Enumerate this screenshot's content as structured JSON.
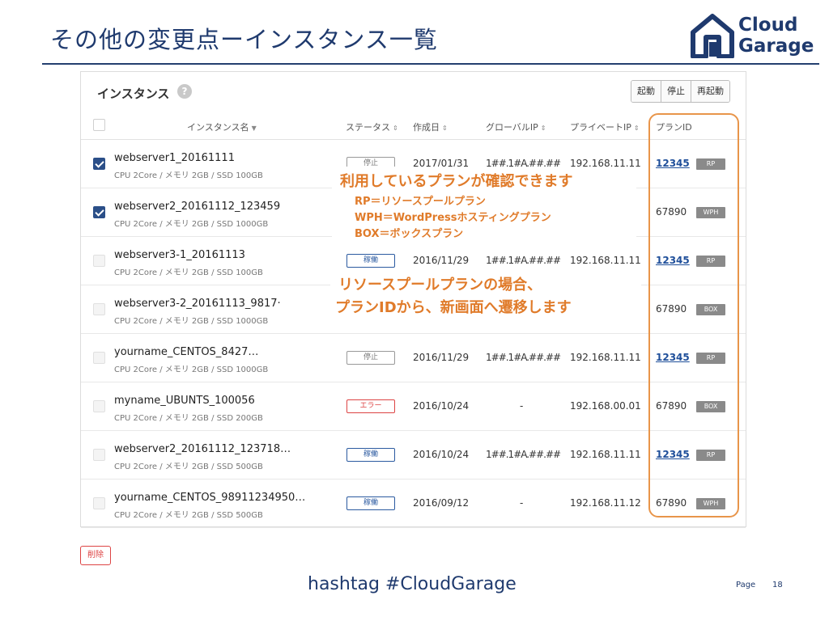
{
  "slide": {
    "title": "その他の変更点ーインスタンス一覧",
    "hashtag": "hashtag  #CloudGarage",
    "page_label": "Page",
    "page_number": "18"
  },
  "logo": {
    "line1": "Cloud",
    "line2": "Garage",
    "color": "#1f3a6e"
  },
  "panel": {
    "title": "インスタンス",
    "help": "?",
    "buttons": [
      "起動",
      "停止",
      "再起動"
    ],
    "headers": {
      "name": "インスタンス名",
      "status": "ステータス",
      "created": "作成日",
      "global_ip": "グローバルIP",
      "private_ip": "プライベートIP",
      "plan_id": "プランID"
    },
    "rows": [
      {
        "checked": true,
        "name": "webserver1_20161111",
        "spec": "CPU 2Core / メモリ 2GB / SSD 100GB",
        "status": "停止",
        "status_type": "stopped",
        "created": "2017/01/31",
        "global_ip": "1##.1#A.##.##",
        "private_ip": "192.168.11.11",
        "plan_id": "12345",
        "plan_link": true,
        "plan_tag": "RP"
      },
      {
        "checked": true,
        "name": "webserver2_20161112_123459",
        "spec": "CPU 2Core / メモリ 2GB / SSD 1000GB",
        "status": "",
        "status_type": "hidden",
        "created": "",
        "global_ip": "",
        "private_ip": "",
        "plan_id": "67890",
        "plan_link": false,
        "plan_tag": "WPH"
      },
      {
        "checked": false,
        "name": "webserver3-1_20161113",
        "spec": "CPU 2Core / メモリ 2GB / SSD 100GB",
        "status": "稼働",
        "status_type": "running",
        "created": "2016/11/29",
        "global_ip": "1##.1#A.##.##",
        "private_ip": "192.168.11.11",
        "plan_id": "12345",
        "plan_link": true,
        "plan_tag": "RP"
      },
      {
        "checked": false,
        "name": "webserver3-2_20161113_9817·",
        "spec": "CPU 2Core / メモリ 2GB / SSD 1000GB",
        "status": "",
        "status_type": "hidden",
        "created": "",
        "global_ip": "",
        "private_ip": "",
        "plan_id": "67890",
        "plan_link": false,
        "plan_tag": "BOX"
      },
      {
        "checked": false,
        "name": "yourname_CENTOS_8427…",
        "spec": "CPU 2Core / メモリ 2GB / SSD 1000GB",
        "status": "停止",
        "status_type": "stopped",
        "created": "2016/11/29",
        "global_ip": "1##.1#A.##.##",
        "private_ip": "192.168.11.11",
        "plan_id": "12345",
        "plan_link": true,
        "plan_tag": "RP"
      },
      {
        "checked": false,
        "name": "myname_UBUNTS_100056",
        "spec": "CPU 2Core / メモリ 2GB / SSD 200GB",
        "status": "エラー",
        "status_type": "error",
        "created": "2016/10/24",
        "global_ip": "-",
        "private_ip": "192.168.00.01",
        "plan_id": "67890",
        "plan_link": false,
        "plan_tag": "BOX"
      },
      {
        "checked": false,
        "name": "webserver2_20161112_123718…",
        "spec": "CPU 2Core / メモリ 2GB / SSD 500GB",
        "status": "稼働",
        "status_type": "running",
        "created": "2016/10/24",
        "global_ip": "1##.1#A.##.##",
        "private_ip": "192.168.11.11",
        "plan_id": "12345",
        "plan_link": true,
        "plan_tag": "RP"
      },
      {
        "checked": false,
        "name": "yourname_CENTOS_98911234950…",
        "spec": "CPU 2Core / メモリ 2GB / SSD 500GB",
        "status": "稼働",
        "status_type": "running",
        "created": "2016/09/12",
        "global_ip": "-",
        "private_ip": "192.168.11.12",
        "plan_id": "67890",
        "plan_link": false,
        "plan_tag": "WPH"
      }
    ],
    "delete_label": "削除"
  },
  "callouts": {
    "plan_check": {
      "title": "利用しているプランが確認できます",
      "lines": [
        "RP＝リソースプールプラン",
        "WPH＝WordPressホスティングプラン",
        "BOX＝ボックスプラン"
      ]
    },
    "resource_pool": {
      "lines": [
        "リソースプールプランの場合、",
        "プランIDから、新画面へ遷移します"
      ]
    }
  },
  "colors": {
    "accent_orange": "#e8954a",
    "brand_navy": "#1f3a6e",
    "link_blue": "#1f4f9a",
    "error_red": "#dd4444"
  }
}
